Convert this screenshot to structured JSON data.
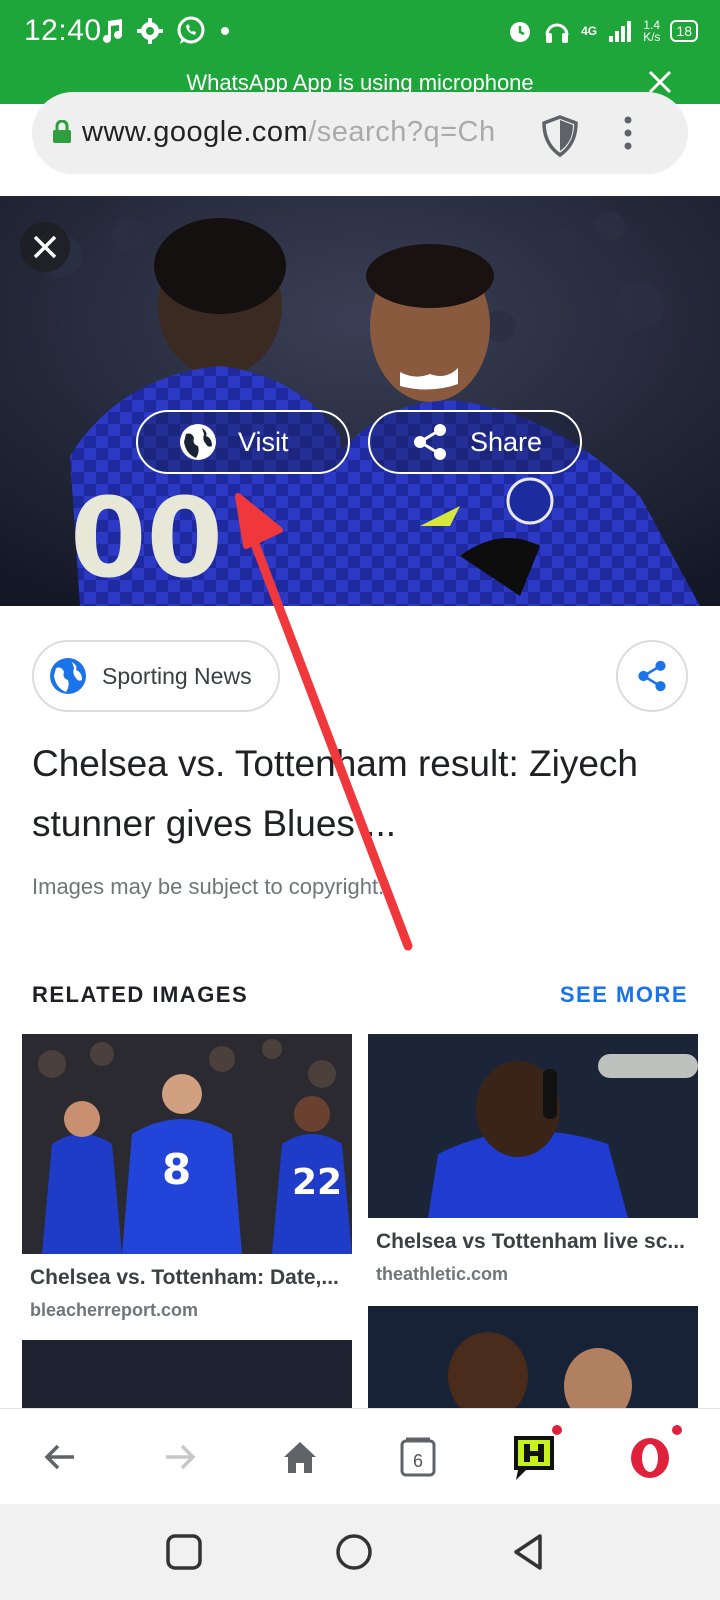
{
  "status_bar": {
    "time": "12:40",
    "net_speed_value": "1.4",
    "net_speed_unit": "K/s",
    "network_type": "4G",
    "battery": "18"
  },
  "mic_banner": {
    "text": "WhatsApp App is using microphone"
  },
  "url_bar": {
    "domain": "www.google.com",
    "path": "/search?q=Ch"
  },
  "hero": {
    "visit_label": "Visit",
    "share_label": "Share"
  },
  "source": {
    "name": "Sporting News"
  },
  "headline": "Chelsea vs. Tottenham result: Ziyech stunner gives Blues ...",
  "copyright_note": "Images may be subject to copyright.",
  "related": {
    "title": "RELATED IMAGES",
    "see_more": "SEE MORE",
    "items": [
      {
        "title": "Chelsea vs. Tottenham: Date,...",
        "source": "bleacherreport.com"
      },
      {
        "title": "Chelsea vs Tottenham live sc...",
        "source": "theathletic.com"
      }
    ]
  },
  "bottom_bar": {
    "tab_count": "6"
  },
  "colors": {
    "status_green": "#1fa63b",
    "link_blue": "#1a73e8",
    "annotation_red": "#f0373b"
  }
}
